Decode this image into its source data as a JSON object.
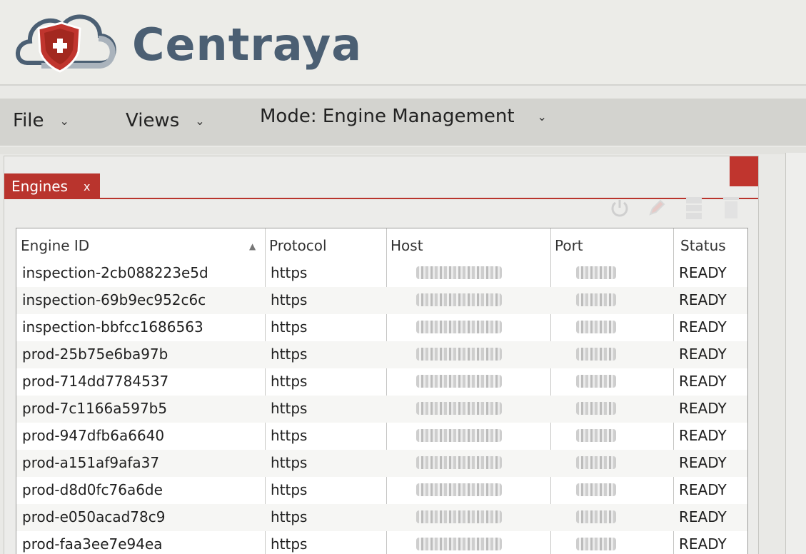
{
  "brand": {
    "name": "Centraya"
  },
  "menu": {
    "file": "File",
    "views": "Views",
    "mode": "Mode: Engine Management"
  },
  "tab": {
    "label": "Engines",
    "close": "x"
  },
  "colors": {
    "accent": "#b9342d",
    "brand_text": "#4b5f73"
  },
  "toolbar_icons": [
    "power-icon",
    "edit-icon",
    "server-icon",
    "delete-icon"
  ],
  "table": {
    "columns": [
      "Engine ID",
      "Protocol",
      "Host",
      "Port",
      "Status"
    ],
    "sort_column": "Engine ID",
    "rows": [
      {
        "engine_id": "inspection-2cb088223e5d",
        "protocol": "https",
        "status": "READY"
      },
      {
        "engine_id": "inspection-69b9ec952c6c",
        "protocol": "https",
        "status": "READY"
      },
      {
        "engine_id": "inspection-bbfcc1686563",
        "protocol": "https",
        "status": "READY"
      },
      {
        "engine_id": "prod-25b75e6ba97b",
        "protocol": "https",
        "status": "READY"
      },
      {
        "engine_id": "prod-714dd7784537",
        "protocol": "https",
        "status": "READY"
      },
      {
        "engine_id": "prod-7c1166a597b5",
        "protocol": "https",
        "status": "READY"
      },
      {
        "engine_id": "prod-947dfb6a6640",
        "protocol": "https",
        "status": "READY"
      },
      {
        "engine_id": "prod-a151af9afa37",
        "protocol": "https",
        "status": "READY"
      },
      {
        "engine_id": "prod-d8d0fc76a6de",
        "protocol": "https",
        "status": "READY"
      },
      {
        "engine_id": "prod-e050acad78c9",
        "protocol": "https",
        "status": "READY"
      },
      {
        "engine_id": "prod-faa3ee7e94ea",
        "protocol": "https",
        "status": "READY"
      }
    ]
  }
}
